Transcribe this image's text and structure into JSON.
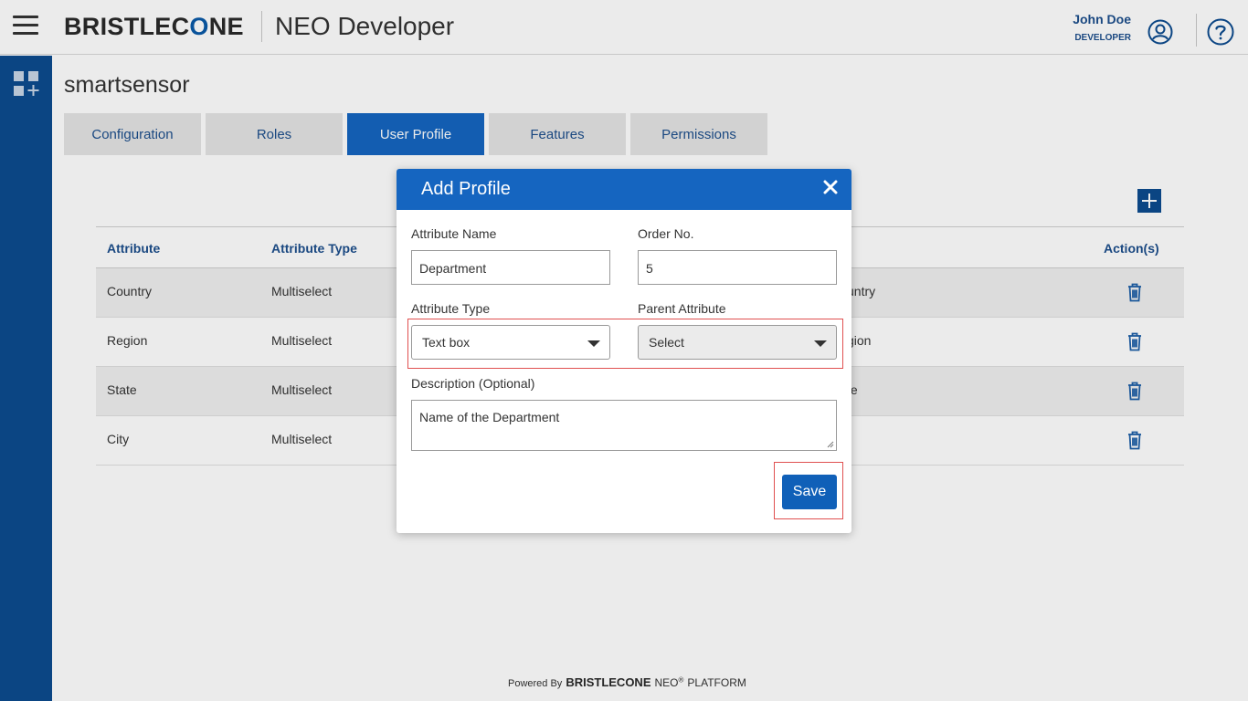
{
  "header": {
    "logo_left": "BRISTLEC",
    "logo_o": "O",
    "logo_right": "NE",
    "app_title": "NEO Developer",
    "user_name": "John Doe",
    "user_role": "DEVELOPER"
  },
  "page": {
    "title": "smartsensor"
  },
  "tabs": [
    {
      "label": "Configuration",
      "active": false
    },
    {
      "label": "Roles",
      "active": false
    },
    {
      "label": "User Profile",
      "active": true
    },
    {
      "label": "Features",
      "active": false
    },
    {
      "label": "Permissions",
      "active": false
    }
  ],
  "table": {
    "headers": {
      "attribute": "Attribute",
      "attribute_type": "Attribute Type",
      "actions": "Action(s)"
    },
    "rows": [
      {
        "attribute": "Country",
        "type": "Multiselect",
        "partial": "untry"
      },
      {
        "attribute": "Region",
        "type": "Multiselect",
        "partial": "gion"
      },
      {
        "attribute": "State",
        "type": "Multiselect",
        "partial": "te"
      },
      {
        "attribute": "City",
        "type": "Multiselect",
        "partial": ""
      }
    ]
  },
  "modal": {
    "title": "Add Profile",
    "attribute_name_label": "Attribute Name",
    "attribute_name_value": "Department",
    "order_no_label": "Order No.",
    "order_no_value": "5",
    "attribute_type_label": "Attribute Type",
    "attribute_type_value": "Text box",
    "parent_attribute_label": "Parent Attribute",
    "parent_attribute_value": "Select",
    "description_label": "Description (Optional)",
    "description_value": "Name of the Department",
    "save_label": "Save"
  },
  "footer": {
    "powered_by": "Powered By",
    "brand": "BRISTLECONE",
    "neo": "NEO",
    "reg": "®",
    "platform": "PLATFORM"
  },
  "colors": {
    "primary": "#1565c0",
    "sidebar": "#0d4b8f",
    "link_text": "#1d4f8c",
    "highlight": "#e05050"
  }
}
